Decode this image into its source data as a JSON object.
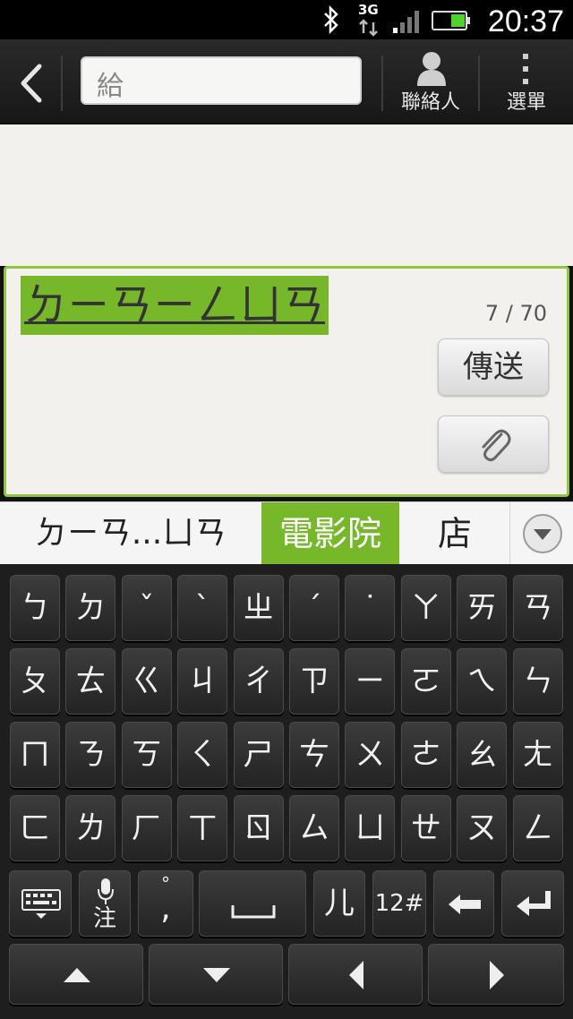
{
  "status_bar": {
    "time": "20:37",
    "network": "3G"
  },
  "header": {
    "to_placeholder": "給",
    "contacts_label": "聯絡人",
    "menu_label": "選單"
  },
  "compose": {
    "text": "ㄉㄧㄢㄧㄥㄩㄢ",
    "counter": "7 / 70",
    "send_label": "傳送"
  },
  "candidates": [
    "ㄉㄧㄢ...ㄩㄢ",
    "電影院",
    "店"
  ],
  "keyboard": {
    "rows": [
      [
        "ㄅ",
        "ㄉ",
        "ˇ",
        "ˋ",
        "ㄓ",
        "ˊ",
        "˙",
        "ㄚ",
        "ㄞ",
        "ㄢ"
      ],
      [
        "ㄆ",
        "ㄊ",
        "ㄍ",
        "ㄐ",
        "ㄔ",
        "ㄗ",
        "ㄧ",
        "ㄛ",
        "ㄟ",
        "ㄣ"
      ],
      [
        "ㄇ",
        "ㄋ",
        "ㄎ",
        "ㄑ",
        "ㄕ",
        "ㄘ",
        "ㄨ",
        "ㄜ",
        "ㄠ",
        "ㄤ"
      ],
      [
        "ㄈ",
        "ㄌ",
        "ㄏ",
        "ㄒ",
        "ㄖ",
        "ㄙ",
        "ㄩ",
        "ㄝ",
        "ㄡ",
        "ㄥ"
      ]
    ],
    "mic_label": "注",
    "punct_top": "°",
    "punct_bottom": ",",
    "er_key": "儿",
    "num_key": "12#"
  },
  "colors": {
    "accent": "#76b82a",
    "keyboard_bg": "#1e1e1e"
  }
}
